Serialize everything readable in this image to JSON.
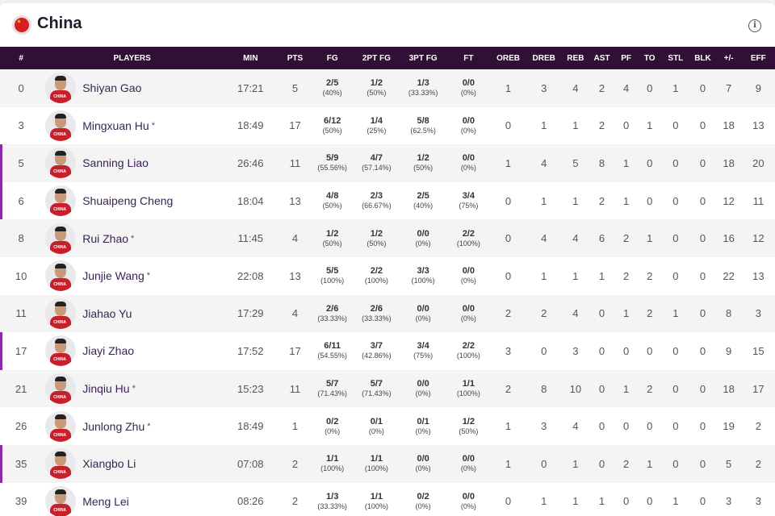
{
  "team": {
    "name": "China"
  },
  "columns": {
    "num": "#",
    "players": "PLAYERS",
    "min": "MIN",
    "pts": "PTS",
    "fg": "FG",
    "fg2": "2PT FG",
    "fg3": "3PT FG",
    "ft": "FT",
    "oreb": "OREB",
    "dreb": "DREB",
    "reb": "REB",
    "ast": "AST",
    "pf": "PF",
    "to": "TO",
    "stl": "STL",
    "blk": "BLK",
    "pm": "+/-",
    "eff": "EFF"
  },
  "players": [
    {
      "num": "0",
      "name": "Shiyan Gao",
      "star": "",
      "starter": false,
      "min": "17:21",
      "pts": "5",
      "fg": "2/5",
      "fg_pct": "(40%)",
      "fg2": "1/2",
      "fg2_pct": "(50%)",
      "fg3": "1/3",
      "fg3_pct": "(33.33%)",
      "ft": "0/0",
      "ft_pct": "(0%)",
      "oreb": "1",
      "dreb": "3",
      "reb": "4",
      "ast": "2",
      "pf": "4",
      "to": "0",
      "stl": "1",
      "blk": "0",
      "pm": "7",
      "eff": "9"
    },
    {
      "num": "3",
      "name": "Mingxuan Hu",
      "star": "*",
      "starter": false,
      "min": "18:49",
      "pts": "17",
      "fg": "6/12",
      "fg_pct": "(50%)",
      "fg2": "1/4",
      "fg2_pct": "(25%)",
      "fg3": "5/8",
      "fg3_pct": "(62.5%)",
      "ft": "0/0",
      "ft_pct": "(0%)",
      "oreb": "0",
      "dreb": "1",
      "reb": "1",
      "ast": "2",
      "pf": "0",
      "to": "1",
      "stl": "0",
      "blk": "0",
      "pm": "18",
      "eff": "13"
    },
    {
      "num": "5",
      "name": "Sanning Liao",
      "star": "",
      "starter": true,
      "min": "26:46",
      "pts": "11",
      "fg": "5/9",
      "fg_pct": "(55.56%)",
      "fg2": "4/7",
      "fg2_pct": "(57.14%)",
      "fg3": "1/2",
      "fg3_pct": "(50%)",
      "ft": "0/0",
      "ft_pct": "(0%)",
      "oreb": "1",
      "dreb": "4",
      "reb": "5",
      "ast": "8",
      "pf": "1",
      "to": "0",
      "stl": "0",
      "blk": "0",
      "pm": "18",
      "eff": "20"
    },
    {
      "num": "6",
      "name": "Shuaipeng Cheng",
      "star": "",
      "starter": true,
      "min": "18:04",
      "pts": "13",
      "fg": "4/8",
      "fg_pct": "(50%)",
      "fg2": "2/3",
      "fg2_pct": "(66.67%)",
      "fg3": "2/5",
      "fg3_pct": "(40%)",
      "ft": "3/4",
      "ft_pct": "(75%)",
      "oreb": "0",
      "dreb": "1",
      "reb": "1",
      "ast": "2",
      "pf": "1",
      "to": "0",
      "stl": "0",
      "blk": "0",
      "pm": "12",
      "eff": "11"
    },
    {
      "num": "8",
      "name": "Rui Zhao",
      "star": "*",
      "starter": false,
      "min": "11:45",
      "pts": "4",
      "fg": "1/2",
      "fg_pct": "(50%)",
      "fg2": "1/2",
      "fg2_pct": "(50%)",
      "fg3": "0/0",
      "fg3_pct": "(0%)",
      "ft": "2/2",
      "ft_pct": "(100%)",
      "oreb": "0",
      "dreb": "4",
      "reb": "4",
      "ast": "6",
      "pf": "2",
      "to": "1",
      "stl": "0",
      "blk": "0",
      "pm": "16",
      "eff": "12"
    },
    {
      "num": "10",
      "name": "Junjie Wang",
      "star": "*",
      "starter": false,
      "min": "22:08",
      "pts": "13",
      "fg": "5/5",
      "fg_pct": "(100%)",
      "fg2": "2/2",
      "fg2_pct": "(100%)",
      "fg3": "3/3",
      "fg3_pct": "(100%)",
      "ft": "0/0",
      "ft_pct": "(0%)",
      "oreb": "0",
      "dreb": "1",
      "reb": "1",
      "ast": "1",
      "pf": "2",
      "to": "2",
      "stl": "0",
      "blk": "0",
      "pm": "22",
      "eff": "13"
    },
    {
      "num": "11",
      "name": "Jiahao Yu",
      "star": "",
      "starter": false,
      "min": "17:29",
      "pts": "4",
      "fg": "2/6",
      "fg_pct": "(33.33%)",
      "fg2": "2/6",
      "fg2_pct": "(33.33%)",
      "fg3": "0/0",
      "fg3_pct": "(0%)",
      "ft": "0/0",
      "ft_pct": "(0%)",
      "oreb": "2",
      "dreb": "2",
      "reb": "4",
      "ast": "0",
      "pf": "1",
      "to": "2",
      "stl": "1",
      "blk": "0",
      "pm": "8",
      "eff": "3"
    },
    {
      "num": "17",
      "name": "Jiayi Zhao",
      "star": "",
      "starter": true,
      "min": "17:52",
      "pts": "17",
      "fg": "6/11",
      "fg_pct": "(54.55%)",
      "fg2": "3/7",
      "fg2_pct": "(42.86%)",
      "fg3": "3/4",
      "fg3_pct": "(75%)",
      "ft": "2/2",
      "ft_pct": "(100%)",
      "oreb": "3",
      "dreb": "0",
      "reb": "3",
      "ast": "0",
      "pf": "0",
      "to": "0",
      "stl": "0",
      "blk": "0",
      "pm": "9",
      "eff": "15"
    },
    {
      "num": "21",
      "name": "Jinqiu Hu",
      "star": "*",
      "starter": false,
      "min": "15:23",
      "pts": "11",
      "fg": "5/7",
      "fg_pct": "(71.43%)",
      "fg2": "5/7",
      "fg2_pct": "(71.43%)",
      "fg3": "0/0",
      "fg3_pct": "(0%)",
      "ft": "1/1",
      "ft_pct": "(100%)",
      "oreb": "2",
      "dreb": "8",
      "reb": "10",
      "ast": "0",
      "pf": "1",
      "to": "2",
      "stl": "0",
      "blk": "0",
      "pm": "18",
      "eff": "17"
    },
    {
      "num": "26",
      "name": "Junlong Zhu",
      "star": "*",
      "starter": false,
      "min": "18:49",
      "pts": "1",
      "fg": "0/2",
      "fg_pct": "(0%)",
      "fg2": "0/1",
      "fg2_pct": "(0%)",
      "fg3": "0/1",
      "fg3_pct": "(0%)",
      "ft": "1/2",
      "ft_pct": "(50%)",
      "oreb": "1",
      "dreb": "3",
      "reb": "4",
      "ast": "0",
      "pf": "0",
      "to": "0",
      "stl": "0",
      "blk": "0",
      "pm": "19",
      "eff": "2"
    },
    {
      "num": "35",
      "name": "Xiangbo Li",
      "star": "",
      "starter": true,
      "min": "07:08",
      "pts": "2",
      "fg": "1/1",
      "fg_pct": "(100%)",
      "fg2": "1/1",
      "fg2_pct": "(100%)",
      "fg3": "0/0",
      "fg3_pct": "(0%)",
      "ft": "0/0",
      "ft_pct": "(0%)",
      "oreb": "1",
      "dreb": "0",
      "reb": "1",
      "ast": "0",
      "pf": "2",
      "to": "1",
      "stl": "0",
      "blk": "0",
      "pm": "5",
      "eff": "2"
    },
    {
      "num": "39",
      "name": "Meng Lei",
      "star": "",
      "starter": false,
      "min": "08:26",
      "pts": "2",
      "fg": "1/3",
      "fg_pct": "(33.33%)",
      "fg2": "1/1",
      "fg2_pct": "(100%)",
      "fg3": "0/2",
      "fg3_pct": "(0%)",
      "ft": "0/0",
      "ft_pct": "(0%)",
      "oreb": "0",
      "dreb": "1",
      "reb": "1",
      "ast": "1",
      "pf": "0",
      "to": "0",
      "stl": "1",
      "blk": "0",
      "pm": "3",
      "eff": "3"
    }
  ]
}
